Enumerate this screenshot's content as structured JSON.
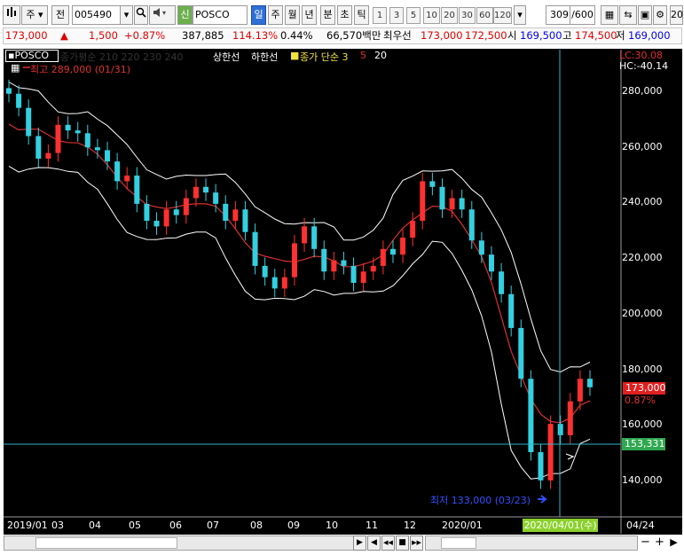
{
  "toolbar": {
    "period_label": "주",
    "prev_label": "전",
    "code": "005490",
    "stock_label": "신",
    "stock_name": "POSCO",
    "day": "일",
    "week": "주",
    "month": "월",
    "year": "년",
    "minute": "분",
    "second": "초",
    "tick": "틱",
    "periods": [
      "1",
      "3",
      "5",
      "10",
      "20",
      "30",
      "60",
      "120"
    ],
    "count": "309",
    "total": "/600",
    "edge": "20"
  },
  "quote": {
    "price": "173,000",
    "change": "1,500",
    "pct": "+0.87%",
    "volume": "387,885",
    "vol_ratio": "114.13%",
    "turnover": "0.44%",
    "amount": "66,570백만",
    "ask_label": "최우선",
    "ask": "173,000",
    "bid": "172,500",
    "open_label": "시",
    "open": "169,500",
    "high_label": "고",
    "high": "174,500",
    "low_label": "저",
    "low": "169,000"
  },
  "legend": {
    "title": "POSCO",
    "mas": "종가평순 210 220 230 240",
    "limit_up": "상한선",
    "limit_down": "하한선",
    "bb": "종가 단순 3",
    "bb5": "5",
    "bb20": "20",
    "max_label": "최고 289,000 (01/31)"
  },
  "price_axis": {
    "lc": "LC:30.08",
    "hc": "HC:-40.14",
    "ticks": [
      "280,000",
      "260,000",
      "240,000",
      "220,000",
      "200,000",
      "180,000",
      "160,000",
      "140,000"
    ],
    "last_price": "173,000",
    "last_pct": "0.87%",
    "cross_value": "153,331"
  },
  "min_label": "최저 133,000 (03/23)",
  "x_axis": {
    "labels": [
      "2019/01",
      "03",
      "04",
      "05",
      "06",
      "07",
      "08",
      "09",
      "10",
      "11",
      "12",
      "2020/01",
      "04/24"
    ],
    "cursor_date": "2020/04/01(수)"
  },
  "scrollbar": {
    "ctrls": [
      "▶",
      "◀",
      "◀◀",
      "■",
      "▶▶",
      "−",
      "+"
    ]
  },
  "chart_data": {
    "type": "line",
    "series": [
      {
        "name": "POSCO",
        "values": [
          277000,
          272000,
          262000,
          254000,
          256000,
          266000,
          264000,
          263000,
          258000,
          257000,
          253000,
          246000,
          248000,
          238000,
          232000,
          230000,
          236000,
          234000,
          240000,
          244000,
          242000,
          238000,
          232000,
          236000,
          228000,
          216000,
          212000,
          208000,
          212000,
          224000,
          230000,
          222000,
          214000,
          218000,
          216000,
          210000,
          214000,
          216000,
          222000,
          220000,
          226000,
          232000,
          246000,
          244000,
          236000,
          240000,
          236000,
          225000,
          220000,
          214000,
          206000,
          194000,
          176000,
          150000,
          140000,
          160000,
          156000,
          168000,
          176000,
          173000
        ]
      }
    ],
    "x": [
      "2019/01",
      "03",
      "04",
      "05",
      "06",
      "07",
      "08",
      "09",
      "10",
      "11",
      "12",
      "2020/01",
      "04/24"
    ],
    "ylim": [
      128000,
      292000
    ]
  }
}
